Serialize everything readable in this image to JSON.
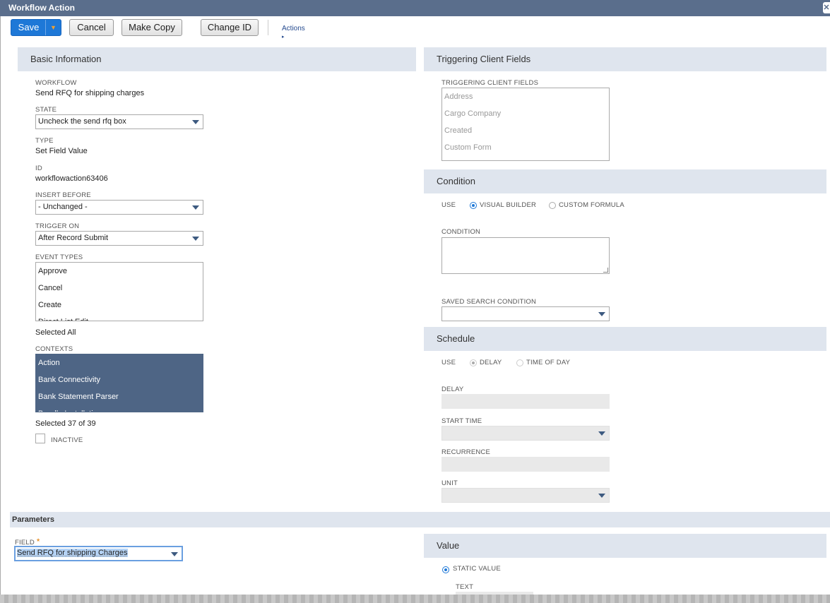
{
  "window": {
    "title": "Workflow Action"
  },
  "toolbar": {
    "save": "Save",
    "cancel": "Cancel",
    "make_copy": "Make Copy",
    "change_id": "Change ID",
    "actions": "Actions"
  },
  "basic": {
    "header": "Basic Information",
    "workflow_label": "WORKFLOW",
    "workflow_value": "Send RFQ for shipping charges",
    "state_label": "STATE",
    "state_value": "Uncheck the send rfq box",
    "type_label": "TYPE",
    "type_value": "Set Field Value",
    "id_label": "ID",
    "id_value": "workflowaction63406",
    "insert_before_label": "INSERT BEFORE",
    "insert_before_value": "- Unchanged -",
    "trigger_on_label": "TRIGGER ON",
    "trigger_on_value": "After Record Submit",
    "event_types_label": "EVENT TYPES",
    "event_types": [
      "Approve",
      "Cancel",
      "Create",
      "Direct List Edit"
    ],
    "event_types_summary": "Selected All",
    "contexts_label": "CONTEXTS",
    "contexts": [
      "Action",
      "Bank Connectivity",
      "Bank Statement Parser",
      "Bundle Installation"
    ],
    "contexts_summary": "Selected 37 of 39",
    "inactive_label": "INACTIVE"
  },
  "triggering": {
    "header": "Triggering Client Fields",
    "label": "TRIGGERING CLIENT FIELDS",
    "items": [
      "Address",
      "Cargo Company",
      "Created",
      "Custom Form"
    ]
  },
  "condition": {
    "header": "Condition",
    "use_label": "USE",
    "opt_visual": "VISUAL BUILDER",
    "opt_formula": "CUSTOM FORMULA",
    "condition_label": "CONDITION",
    "saved_search_label": "SAVED SEARCH CONDITION"
  },
  "schedule": {
    "header": "Schedule",
    "use_label": "USE",
    "opt_delay": "DELAY",
    "opt_time": "TIME OF DAY",
    "delay_label": "DELAY",
    "start_time_label": "START TIME",
    "recurrence_label": "RECURRENCE",
    "unit_label": "UNIT"
  },
  "parameters": {
    "header": "Parameters",
    "field_label": "FIELD",
    "field_value": "Send RFQ for shipping Charges"
  },
  "value": {
    "header": "Value",
    "static_label": "STATIC VALUE",
    "text_label": "TEXT"
  },
  "colors": {
    "title_bar": "#5a6e8c",
    "section_header": "#dfe5ee",
    "primary_button": "#1e78d7",
    "selected_list": "#4e6585"
  }
}
